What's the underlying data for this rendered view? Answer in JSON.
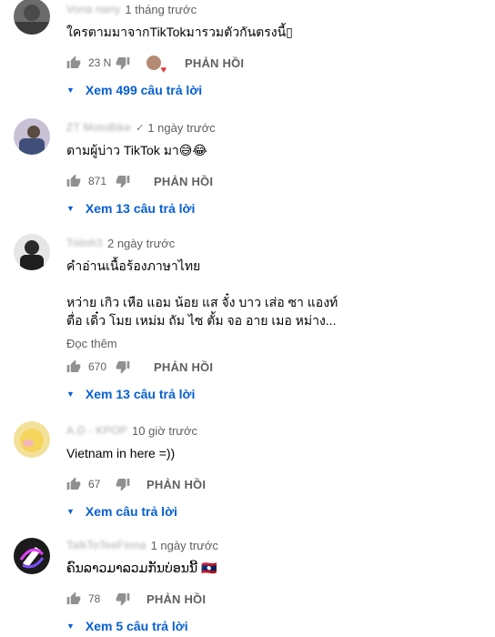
{
  "labels": {
    "reply": "PHẢN HỒI",
    "read_more": "Đọc thêm"
  },
  "colors": {
    "link": "#065fd4",
    "muted": "#606060",
    "icon": "#909090"
  },
  "comments": [
    {
      "author": "Vona nany",
      "verified": false,
      "time": "1 tháng trước",
      "text": "ใครตามมาจากTikTokมารวมตัวกันตรงนี้▯",
      "likes": "23 N",
      "hearted": true,
      "replies": "Xem 499 câu trả lời"
    },
    {
      "author": "ZT MotoBike",
      "verified": true,
      "time": "1 ngày trước",
      "text": "ตามผู้บ่าว TikTok มา😅😂",
      "likes": "871",
      "hearted": false,
      "replies": "Xem 13 câu trả lời"
    },
    {
      "author": "Tiiiinh3",
      "verified": false,
      "time": "2 ngày trước",
      "text": "คำอ่านเนื้อร้องภาษาไทย\n\nหว่าย เกิว เหือ แอม น้อย แส จั๋ง บาว เส่อ ซา แองท์\nตื่อ เดิ๋ว โมย เหม่ม ถัม ไซ ตั้ม จอ อาย เมอ หม่าง...",
      "read_more": true,
      "likes": "670",
      "hearted": false,
      "replies": "Xem 13 câu trả lời"
    },
    {
      "author": "A.D - KPOP",
      "verified": false,
      "time": "10 giờ trước",
      "text": "Vietnam in here =))",
      "likes": "67",
      "hearted": false,
      "replies": "Xem câu trả lời"
    },
    {
      "author": "TalkToTeeFiona",
      "verified": false,
      "time": "1 ngày trước",
      "text": "ຄົນລາວມາລວມກັນບ່ອນນີ້ 🇱🇦",
      "likes": "78",
      "hearted": false,
      "replies": "Xem 5 câu trả lời"
    }
  ]
}
